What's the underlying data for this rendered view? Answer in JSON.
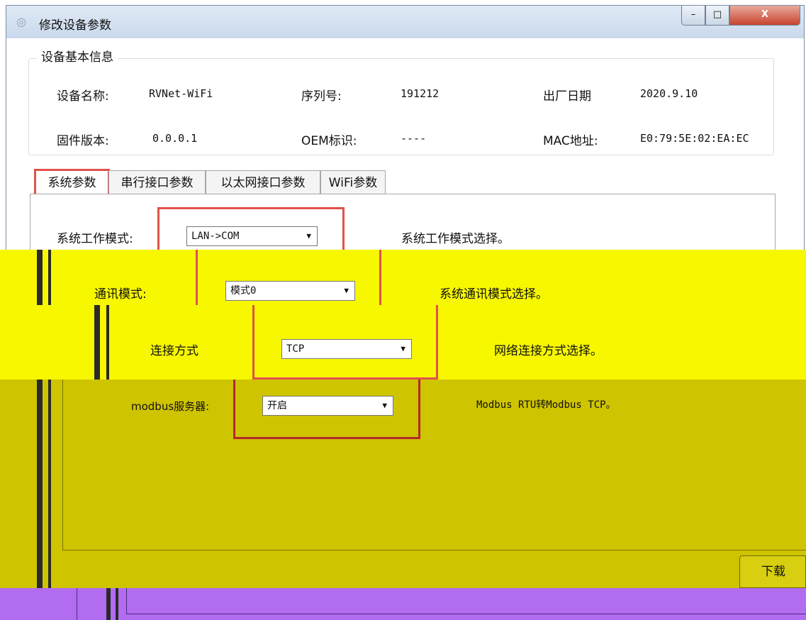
{
  "window": {
    "title": "修改设备参数",
    "controls": {
      "minimize": "–",
      "maximize": "□",
      "close": "X"
    }
  },
  "basic_info": {
    "group_title": "设备基本信息",
    "device_name_label": "设备名称:",
    "device_name_value": "RVNet-WiFi",
    "serial_label": "序列号:",
    "serial_value": "191212",
    "factory_date_label": "出厂日期",
    "factory_date_value": "2020.9.10",
    "firmware_label": "固件版本:",
    "firmware_value": "0.0.0.1",
    "oem_label": "OEM标识:",
    "oem_value": "----",
    "mac_label": "MAC地址:",
    "mac_value": "E0:79:5E:02:EA:EC"
  },
  "tabs": [
    {
      "label": "系统参数",
      "active": true
    },
    {
      "label": "串行接口参数",
      "active": false
    },
    {
      "label": "以太网接口参数",
      "active": false
    },
    {
      "label": "WiFi参数",
      "active": false
    }
  ],
  "system_params": {
    "work_mode_label": "系统工作模式:",
    "work_mode_value": "LAN->COM",
    "work_mode_hint": "系统工作模式选择。",
    "comm_mode_label": "通讯模式:",
    "comm_mode_value": "模式0",
    "comm_mode_hint": "系统通讯模式选择。",
    "conn_label": "连接方式",
    "conn_value": "TCP",
    "conn_hint": "网络连接方式选择。",
    "modbus_label": "modbus服务器:",
    "modbus_value": "开启",
    "modbus_hint": "Modbus RTU转Modbus TCP。"
  },
  "footer": {
    "download_button": "下载"
  },
  "colors": {
    "highlight": "#e0524a",
    "band_yellow": "#f7f700",
    "band_olive": "#cfc400",
    "band_purple": "#b26cf0"
  }
}
